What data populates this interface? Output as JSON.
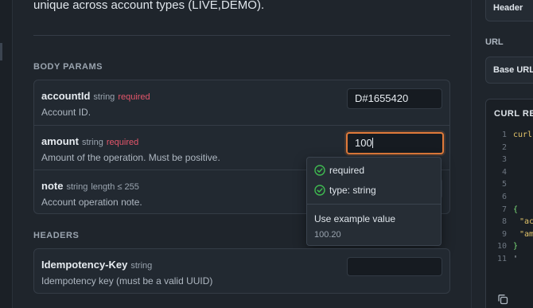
{
  "top_description": "unique across account types (LIVE,DEMO).",
  "body_params": {
    "title": "BODY PARAMS",
    "items": [
      {
        "name": "accountId",
        "type": "string",
        "required": "required",
        "constraint": "",
        "description": "Account ID.",
        "value": "D#1655420"
      },
      {
        "name": "amount",
        "type": "string",
        "required": "required",
        "constraint": "",
        "description": "Amount of the operation. Must be positive.",
        "value": "100"
      },
      {
        "name": "note",
        "type": "string",
        "required": "",
        "constraint": "length ≤ 255",
        "description": "Account operation note.",
        "value": ""
      }
    ]
  },
  "popover": {
    "checks": [
      "required",
      "type: string"
    ],
    "example_title": "Use example value",
    "example_value": "100.20"
  },
  "headers": {
    "title": "HEADERS",
    "items": [
      {
        "name": "Idempotency-Key",
        "type": "string",
        "description": "Idempotency key (must be a valid UUID)",
        "value": ""
      }
    ]
  },
  "right_panel": {
    "header_button": "Header",
    "url_label": "URL",
    "base_url_button": "Base URL",
    "curl_title": "CURL REQUEST",
    "code_lines": [
      {
        "n": "1",
        "text": "curl"
      },
      {
        "n": "2",
        "text": ""
      },
      {
        "n": "3",
        "text": ""
      },
      {
        "n": "4",
        "text": ""
      },
      {
        "n": "5",
        "text": ""
      },
      {
        "n": "6",
        "text": ""
      },
      {
        "n": "7",
        "text": "{"
      },
      {
        "n": "8",
        "text": "\"ac"
      },
      {
        "n": "9",
        "text": "\"am"
      },
      {
        "n": "10",
        "text": "}"
      },
      {
        "n": "11",
        "text": "'"
      }
    ]
  },
  "colors": {
    "accent_focus": "#e07a3a",
    "required": "#e5566b",
    "check_green": "#3fb950",
    "code_cmd": "#e3c46a",
    "code_brace": "#7ee07a"
  }
}
